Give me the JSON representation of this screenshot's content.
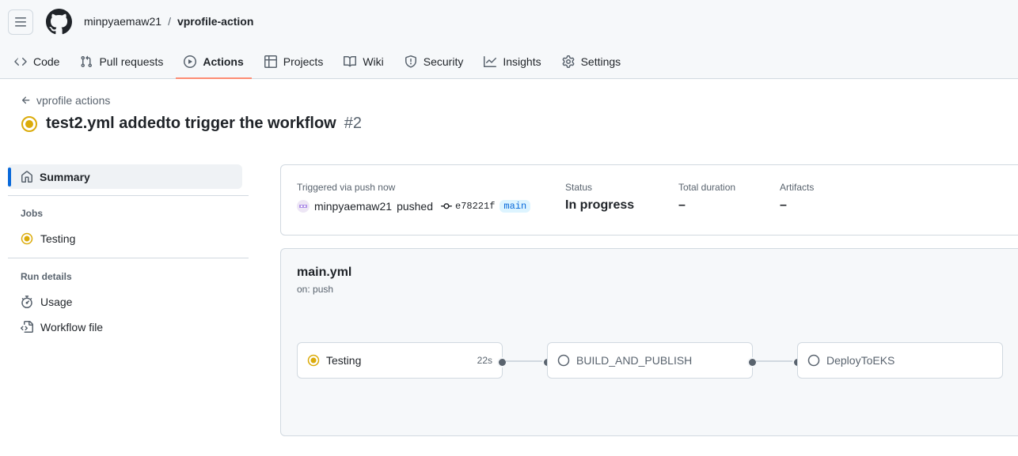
{
  "header": {
    "owner": "minpyaemaw21",
    "separator": "/",
    "repo": "vprofile-action"
  },
  "nav": {
    "tabs": [
      {
        "label": "Code",
        "icon": "code-icon"
      },
      {
        "label": "Pull requests",
        "icon": "pull-request-icon"
      },
      {
        "label": "Actions",
        "icon": "play-icon",
        "active": true
      },
      {
        "label": "Projects",
        "icon": "table-icon"
      },
      {
        "label": "Wiki",
        "icon": "book-icon"
      },
      {
        "label": "Security",
        "icon": "shield-icon"
      },
      {
        "label": "Insights",
        "icon": "graph-icon"
      },
      {
        "label": "Settings",
        "icon": "gear-icon"
      }
    ]
  },
  "run": {
    "back_label": "vprofile actions",
    "title": "test2.yml addedto trigger the workflow",
    "number": "#2",
    "status_color": "#dbab0a"
  },
  "sidebar": {
    "summary_label": "Summary",
    "jobs_heading": "Jobs",
    "jobs": [
      {
        "label": "Testing",
        "status": "in-progress"
      }
    ],
    "run_details_heading": "Run details",
    "run_details": [
      {
        "label": "Usage",
        "icon": "stopwatch-icon"
      },
      {
        "label": "Workflow file",
        "icon": "file-code-icon"
      }
    ]
  },
  "summary": {
    "trigger_label": "Triggered via push now",
    "actor": "minpyaemaw21",
    "action": "pushed",
    "commit_sha": "e78221f",
    "branch": "main",
    "status_label": "Status",
    "status_value": "In progress",
    "duration_label": "Total duration",
    "duration_value": "–",
    "artifacts_label": "Artifacts",
    "artifacts_value": "–"
  },
  "workflow": {
    "name": "main.yml",
    "trigger": "on: push",
    "jobs": [
      {
        "label": "Testing",
        "status": "in-progress",
        "time": "22s"
      },
      {
        "label": "BUILD_AND_PUBLISH",
        "status": "pending",
        "time": ""
      },
      {
        "label": "DeployToEKS",
        "status": "pending",
        "time": ""
      }
    ]
  }
}
